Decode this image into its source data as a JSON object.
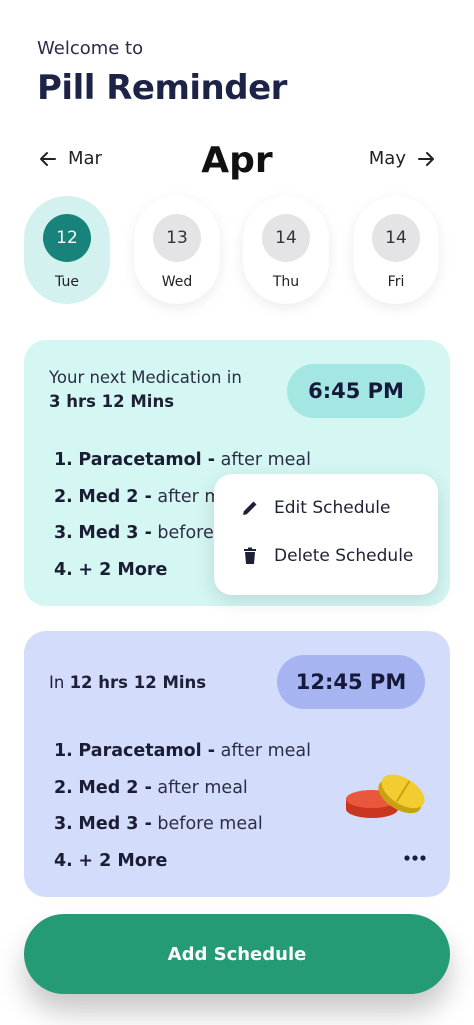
{
  "header": {
    "welcome": "Welcome to",
    "title": "Pill Reminder"
  },
  "month_nav": {
    "prev": "Mar",
    "current": "Apr",
    "next": "May"
  },
  "days": [
    {
      "num": "12",
      "name": "Tue",
      "selected": true
    },
    {
      "num": "13",
      "name": "Wed",
      "selected": false
    },
    {
      "num": "14",
      "name": "Thu",
      "selected": false
    },
    {
      "num": "14",
      "name": "Fri",
      "selected": false
    }
  ],
  "card1": {
    "label": "Your next Medication in",
    "countdown": "3 hrs 12 Mins",
    "time": "6:45 PM",
    "meds": [
      {
        "num": "1.",
        "name": "Paracetamol -",
        "note": "after meal"
      },
      {
        "num": "2.",
        "name": "Med 2 -",
        "note": "after meal"
      },
      {
        "num": "3.",
        "name": "Med 3 -",
        "note": "before meal"
      },
      {
        "num": "4.",
        "name": "+ 2 More",
        "note": ""
      }
    ]
  },
  "context_menu": {
    "edit": "Edit Schedule",
    "delete": "Delete Schedule"
  },
  "card2": {
    "in_prefix": "In",
    "countdown": "12 hrs 12 Mins",
    "time": "12:45 PM",
    "meds": [
      {
        "num": "1.",
        "name": "Paracetamol -",
        "note": "after meal"
      },
      {
        "num": "2.",
        "name": "Med 2 -",
        "note": "after meal"
      },
      {
        "num": "3.",
        "name": "Med 3 -",
        "note": "before meal"
      },
      {
        "num": "4.",
        "name": "+ 2 More",
        "note": ""
      }
    ]
  },
  "add_button": "Add Schedule",
  "icons": {
    "prev": "arrow-left-icon",
    "next": "arrow-right-icon",
    "edit": "pencil-icon",
    "delete": "trash-icon",
    "more": "more-dots-icon",
    "pill": "pill-illustration"
  },
  "colors": {
    "accent": "#17837a",
    "card1_bg": "#d4f7f3",
    "card2_bg": "#d4dcfc",
    "button": "#259a77"
  }
}
